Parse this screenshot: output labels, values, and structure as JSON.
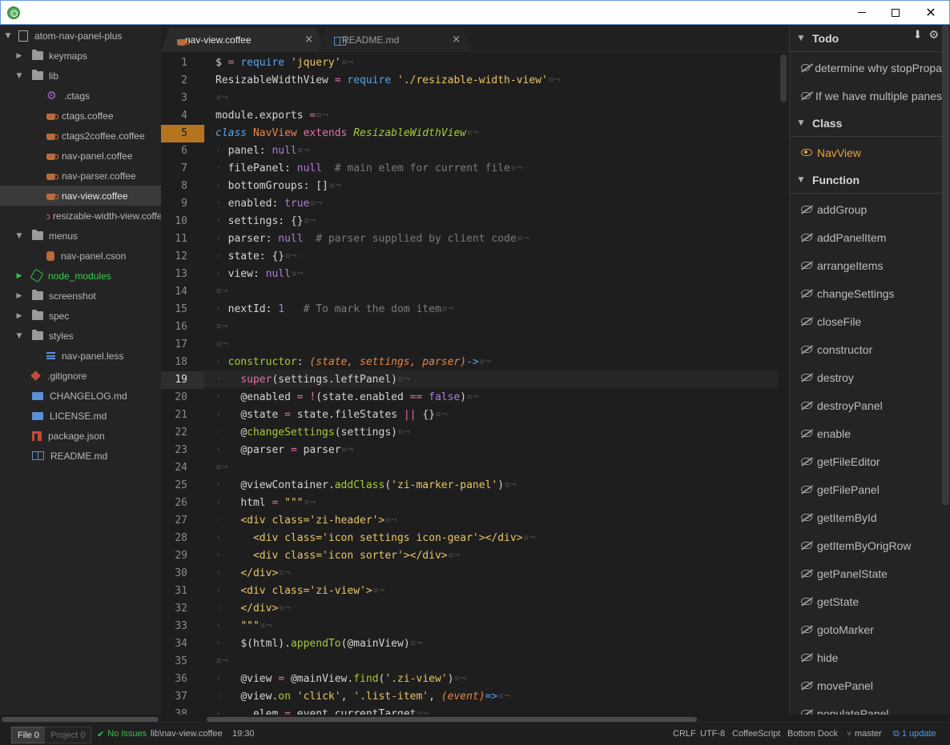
{
  "window": {
    "min_label": "",
    "close_glyph": "✕"
  },
  "tree": {
    "project": "atom-nav-panel-plus",
    "items": [
      {
        "label": "keymaps",
        "kind": "folder",
        "expanded": false
      },
      {
        "label": "lib",
        "kind": "folder",
        "expanded": true
      },
      {
        "label": ".ctags",
        "kind": "gear"
      },
      {
        "label": "ctags.coffee",
        "kind": "coffee"
      },
      {
        "label": "ctags2coffee.coffee",
        "kind": "coffee"
      },
      {
        "label": "nav-panel.coffee",
        "kind": "coffee"
      },
      {
        "label": "nav-parser.coffee",
        "kind": "coffee"
      },
      {
        "label": "nav-view.coffee",
        "kind": "coffee",
        "selected": true
      },
      {
        "label": "resizable-width-view.coffee",
        "kind": "coffee"
      },
      {
        "label": "menus",
        "kind": "folder",
        "expanded": true
      },
      {
        "label": "nav-panel.cson",
        "kind": "cson"
      },
      {
        "label": "node_modules",
        "kind": "node"
      },
      {
        "label": "screenshot",
        "kind": "folder",
        "expanded": false
      },
      {
        "label": "spec",
        "kind": "folder",
        "expanded": false
      },
      {
        "label": "styles",
        "kind": "folder",
        "expanded": true
      },
      {
        "label": "nav-panel.less",
        "kind": "less"
      },
      {
        "label": ".gitignore",
        "kind": "git"
      },
      {
        "label": "CHANGELOG.md",
        "kind": "md"
      },
      {
        "label": "LICENSE.md",
        "kind": "md"
      },
      {
        "label": "package.json",
        "kind": "json"
      },
      {
        "label": "README.md",
        "kind": "readme"
      }
    ]
  },
  "tabs": [
    {
      "label": "nav-view.coffee",
      "active": true,
      "icon": "coffee-icon"
    },
    {
      "label": "README.md",
      "active": false,
      "icon": "book-icon"
    }
  ],
  "editor": {
    "line_numbers": [
      "1",
      "2",
      "3",
      "4",
      "5",
      "6",
      "7",
      "8",
      "9",
      "10",
      "11",
      "12",
      "13",
      "14",
      "15",
      "16",
      "17",
      "18",
      "19",
      "20",
      "21",
      "22",
      "23",
      "24",
      "25",
      "26",
      "27",
      "28",
      "29",
      "30",
      "31",
      "32",
      "33",
      "34",
      "35",
      "36",
      "37",
      "38"
    ],
    "highlighted_line": "5",
    "cursor_line": "19"
  },
  "outline": {
    "sections": [
      {
        "title": "Todo",
        "items": [
          "determine why stopPropa",
          "If we have multiple panes"
        ]
      },
      {
        "title": "Class",
        "items": [
          "NavView"
        ]
      },
      {
        "title": "Function",
        "items": [
          "addGroup",
          "addPanelItem",
          "arrangeItems",
          "changeSettings",
          "closeFile",
          "constructor",
          "destroy",
          "destroyPanel",
          "enable",
          "getFileEditor",
          "getFilePanel",
          "getItemById",
          "getItemByOrigRow",
          "getPanelState",
          "getState",
          "gotoMarker",
          "hide",
          "movePanel",
          "populatePanel"
        ]
      }
    ],
    "active_item": "NavView"
  },
  "status": {
    "file_btn": "File 0",
    "project_btn": "Project 0",
    "issues": "No Issues",
    "path": "lib\\nav-view.coffee",
    "position": "19:30",
    "line_ending": "CRLF",
    "encoding": "UTF-8",
    "grammar": "CoffeeScript",
    "dock": "Bottom Dock",
    "branch": "master",
    "updates": "1 update"
  },
  "colors": {
    "accent": "#b5751e",
    "green": "#37c14a",
    "blue": "#4b9bec",
    "active_outline": "#e8a23a"
  }
}
